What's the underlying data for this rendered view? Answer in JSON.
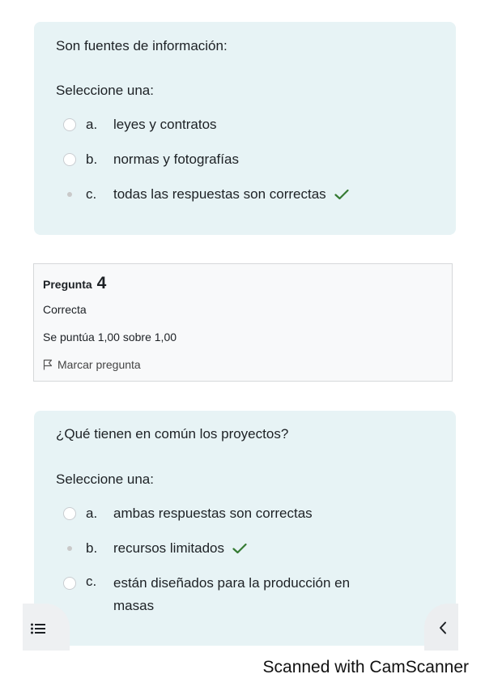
{
  "question3": {
    "text": "Son fuentes de información:",
    "prompt": "Seleccione una:",
    "options": [
      {
        "letter": "a.",
        "text": "leyes y contratos",
        "selected": false,
        "correct": false
      },
      {
        "letter": "b.",
        "text": "normas y fotografías",
        "selected": false,
        "correct": false
      },
      {
        "letter": "c.",
        "text": "todas las respuestas son correctas",
        "selected": true,
        "correct": true
      }
    ]
  },
  "question4_info": {
    "label": "Pregunta",
    "number": "4",
    "state": "Correcta",
    "grade": "Se puntúa 1,00 sobre 1,00",
    "flag_label": "Marcar pregunta"
  },
  "question4": {
    "text": "¿Qué tienen en común los proyectos?",
    "prompt": "Seleccione una:",
    "options": [
      {
        "letter": "a.",
        "text": "ambas respuestas son correctas",
        "selected": false,
        "correct": false
      },
      {
        "letter": "b.",
        "text": "recursos limitados",
        "selected": true,
        "correct": true
      },
      {
        "letter": "c.",
        "text_line1": "están diseñados para la producción en",
        "text_line2": "masas",
        "selected": false,
        "correct": false
      }
    ]
  },
  "footer": {
    "watermark": "Scanned with CamScanner"
  },
  "icons": {
    "drawer": "list-icon",
    "back": "chevron-left-icon",
    "flag": "flag-icon",
    "check": "check-icon"
  },
  "colors": {
    "card_bg": "#e7f3f5",
    "check_green": "#357a32",
    "info_bg": "#f8f9fa"
  }
}
